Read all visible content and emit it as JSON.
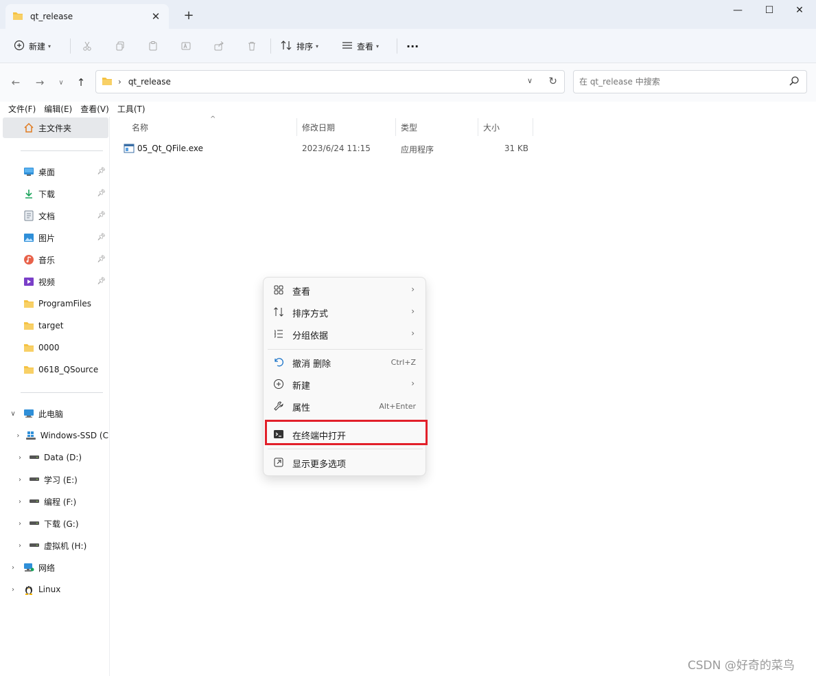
{
  "window": {
    "tab_title": "qt_release",
    "new_tab": "+",
    "controls": {
      "minimize": "—",
      "maximize": "☐",
      "close": "✕"
    }
  },
  "toolbar": {
    "new_label": "新建",
    "sort_label": "排序",
    "view_label": "查看",
    "more_label": "···"
  },
  "navigation": {
    "path": "qt_release",
    "search_placeholder": "在 qt_release 中搜索"
  },
  "menubar": [
    "文件(F)",
    "编辑(E)",
    "查看(V)",
    "工具(T)"
  ],
  "sidebar": {
    "home": "主文件夹",
    "quick_access": [
      {
        "label": "桌面",
        "icon": "desktop-icon",
        "pinned": true
      },
      {
        "label": "下载",
        "icon": "download-icon",
        "pinned": true
      },
      {
        "label": "文档",
        "icon": "document-icon",
        "pinned": true
      },
      {
        "label": "图片",
        "icon": "picture-icon",
        "pinned": true
      },
      {
        "label": "音乐",
        "icon": "music-icon",
        "pinned": true
      },
      {
        "label": "视频",
        "icon": "video-icon",
        "pinned": true
      },
      {
        "label": "ProgramFiles",
        "icon": "folder-icon",
        "pinned": false
      },
      {
        "label": "target",
        "icon": "folder-icon",
        "pinned": false
      },
      {
        "label": "0000",
        "icon": "folder-icon",
        "pinned": false
      },
      {
        "label": "0618_QSource",
        "icon": "folder-icon",
        "pinned": false
      }
    ],
    "this_pc": "此电脑",
    "drives": [
      "Windows-SSD (C",
      "Data (D:)",
      "学习 (E:)",
      "编程 (F:)",
      "下载 (G:)",
      "虚拟机 (H:)"
    ],
    "network": "网络",
    "linux": "Linux"
  },
  "file_list": {
    "columns": [
      "名称",
      "修改日期",
      "类型",
      "大小"
    ],
    "rows": [
      {
        "name": "05_Qt_QFile.exe",
        "modified": "2023/6/24 11:15",
        "type": "应用程序",
        "size": "31 KB"
      }
    ]
  },
  "context_menu": {
    "items": [
      {
        "label": "查看",
        "submenu": true
      },
      {
        "label": "排序方式",
        "submenu": true
      },
      {
        "label": "分组依据",
        "submenu": true
      },
      {
        "label": "撤消 删除",
        "shortcut": "Ctrl+Z"
      },
      {
        "label": "新建",
        "submenu": true
      },
      {
        "label": "属性",
        "shortcut": "Alt+Enter"
      },
      {
        "label": "在终端中打开",
        "highlighted": true
      },
      {
        "label": "显示更多选项"
      }
    ]
  },
  "colors": {
    "highlight_border": "#e2202a",
    "folder": "#f5c242",
    "accent": "#1a73c8"
  },
  "watermark": "CSDN @好奇的菜鸟"
}
